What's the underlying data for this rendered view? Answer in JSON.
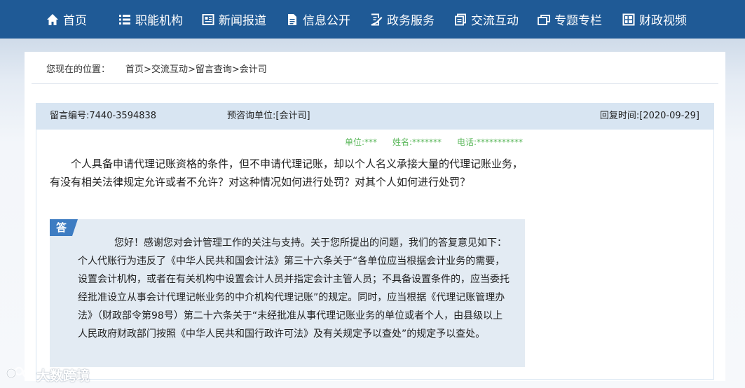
{
  "nav": {
    "items": [
      {
        "label": "首页",
        "icon": "home-icon"
      },
      {
        "label": "职能机构",
        "icon": "list-icon"
      },
      {
        "label": "新闻报道",
        "icon": "newspaper-icon"
      },
      {
        "label": "信息公开",
        "icon": "document-icon"
      },
      {
        "label": "政务服务",
        "icon": "form-icon"
      },
      {
        "label": "交流互动",
        "icon": "chat-icon"
      },
      {
        "label": "专题专栏",
        "icon": "window-icon"
      },
      {
        "label": "财政视频",
        "icon": "video-icon"
      }
    ]
  },
  "breadcrumb": {
    "label": "您现在的位置：",
    "items": [
      "首页",
      "交流互动",
      "留言查询",
      "会计司"
    ],
    "separator": ">"
  },
  "message": {
    "id": "留言编号:7440-3594838",
    "unit": "预咨询单位:[会计司]",
    "reply_time": "回复时间:[2020-09-29]",
    "contact": {
      "unit": "单位:***",
      "name": "姓名:*******",
      "phone": "电话:***********"
    },
    "question": "个人具备申请代理记账资格的条件，但不申请代理记账，却以个人名义承接大量的代理记账业务，有没有相关法律规定允许或者不允许？对这种情况如何进行处罚？对其个人如何进行处罚？",
    "answer_tag": "答",
    "answer": "您好！感谢您对会计管理工作的关注与支持。关于您所提出的问题，我们的答复意见如下：个人代账行为违反了《中华人民共和国会计法》第三十六条关于“各单位应当根据会计业务的需要，设置会计机构，或者在有关机构中设置会计人员并指定会计主管人员；不具备设置条件的，应当委托经批准设立从事会计代理记帐业务的中介机构代理记账”的规定。同时，应当根据《代理记账管理办法》（财政部令第98号）第二十六条关于“未经批准从事代理记账业务的单位或者个人，由县级以上人民政府财政部门按照《中华人民共和国行政许可法》及有关规定予以查处”的规定予以查处。"
  },
  "watermark": {
    "text": "大数跨境"
  },
  "colors": {
    "nav_bg": "#1f5a96",
    "meta_bar": "#d8e5f2",
    "answer_bg": "#e3ebf3",
    "answer_tag": "#3d7cc2",
    "contact_text": "#5cb85c"
  }
}
